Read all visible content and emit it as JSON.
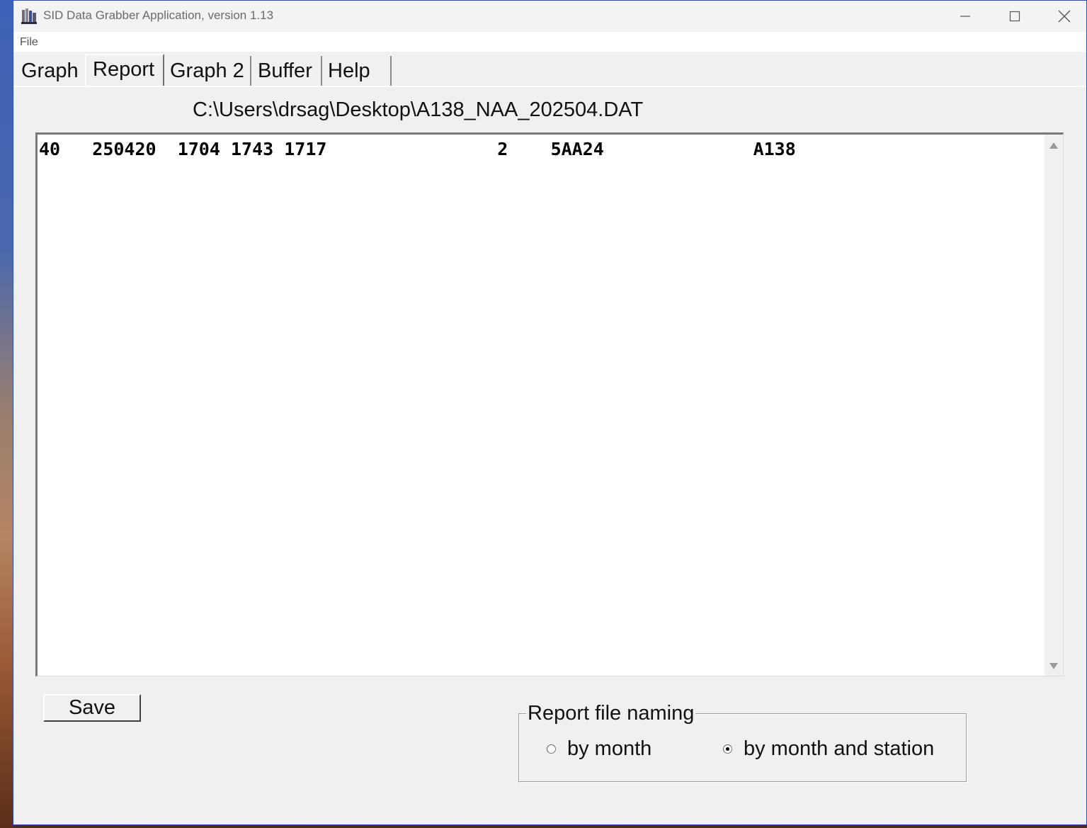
{
  "window": {
    "title": "SID Data Grabber Application, version 1.13",
    "controls": {
      "minimize": "minimize-icon",
      "maximize": "maximize-icon",
      "close": "close-icon"
    }
  },
  "menu": {
    "file_label": "File"
  },
  "tabs": [
    {
      "label": "Graph",
      "active": false
    },
    {
      "label": "Report",
      "active": true
    },
    {
      "label": "Graph 2",
      "active": false
    },
    {
      "label": "Buffer",
      "active": false
    },
    {
      "label": "Help",
      "active": false
    }
  ],
  "report": {
    "file_path": "C:\\Users\\drsag\\Desktop\\A138_NAA_202504.DAT",
    "rows": [
      {
        "col1": "40",
        "col2": "250420",
        "col3": "1704",
        "col4": "1743",
        "col5": "1717",
        "col6": "2",
        "col7": "5AA24",
        "col8": "A138"
      }
    ]
  },
  "actions": {
    "save_label": "Save"
  },
  "naming": {
    "legend": "Report file naming",
    "options": [
      {
        "label": "by month",
        "checked": false
      },
      {
        "label": "by month and station",
        "checked": true
      }
    ]
  },
  "colors": {
    "window_border": "#2b4eb4",
    "window_bg": "#f0f0f0",
    "report_bg": "#ffffff"
  }
}
